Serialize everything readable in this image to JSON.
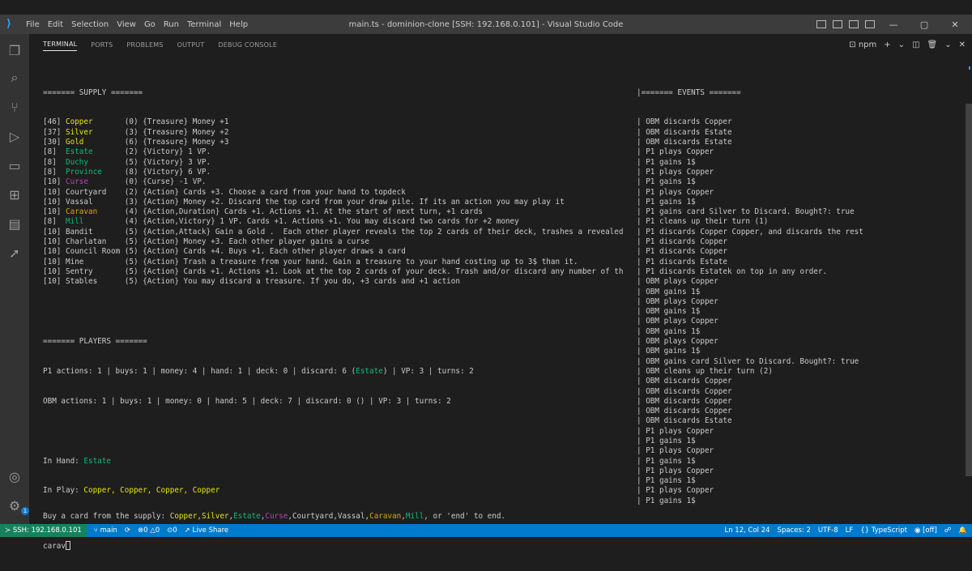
{
  "window": {
    "title": "main.ts - dominion-clone [SSH: 192.168.0.101] - Visual Studio Code",
    "menu": [
      "File",
      "Edit",
      "Selection",
      "View",
      "Go",
      "Run",
      "Terminal",
      "Help"
    ]
  },
  "panel": {
    "tabs": [
      "TERMINAL",
      "PORTS",
      "PROBLEMS",
      "OUTPUT",
      "DEBUG CONSOLE"
    ],
    "active_tab": "TERMINAL",
    "shell_label": "npm"
  },
  "terminal": {
    "supply_header": "======= SUPPLY =======",
    "supply": [
      {
        "count": "[46]",
        "name": "Copper",
        "color": "#e5e510",
        "cost": "(0)",
        "desc": "{Treasure} Money +1"
      },
      {
        "count": "[37]",
        "name": "Silver",
        "color": "#e5e510",
        "cost": "(3)",
        "desc": "{Treasure} Money +2"
      },
      {
        "count": "[30]",
        "name": "Gold",
        "color": "#e5e510",
        "cost": "(6)",
        "desc": "{Treasure} Money +3"
      },
      {
        "count": "[8] ",
        "name": "Estate",
        "color": "#0dbc79",
        "cost": "(2)",
        "desc": "{Victory} 1 VP."
      },
      {
        "count": "[8] ",
        "name": "Duchy",
        "color": "#0dbc79",
        "cost": "(5)",
        "desc": "{Victory} 3 VP."
      },
      {
        "count": "[8] ",
        "name": "Province",
        "color": "#0dbc79",
        "cost": "(8)",
        "desc": "{Victory} 6 VP."
      },
      {
        "count": "[10]",
        "name": "Curse",
        "color": "#bc3fbc",
        "cost": "(0)",
        "desc": "{Curse} -1 VP."
      },
      {
        "count": "[10]",
        "name": "Courtyard",
        "color": "",
        "cost": "(2)",
        "desc": "{Action} Cards +3. Choose a card from your hand to topdeck"
      },
      {
        "count": "[10]",
        "name": "Vassal",
        "color": "",
        "cost": "(3)",
        "desc": "{Action} Money +2. Discard the top card from your draw pile. If its an action you may play it"
      },
      {
        "count": "[10]",
        "name": "Caravan",
        "color": "#e5a00d",
        "cost": "(4)",
        "desc": "{Action,Duration} Cards +1. Actions +1. At the start of next turn, +1 cards"
      },
      {
        "count": "[8] ",
        "name": "Mill",
        "color": "#0dbc79",
        "cost": "(4)",
        "desc": "{Action,Victory} 1 VP. Cards +1. Actions +1. You may discard two cards for +2 money"
      },
      {
        "count": "[10]",
        "name": "Bandit",
        "color": "",
        "cost": "(5)",
        "desc": "{Action,Attack} Gain a Gold .  Each other player reveals the top 2 cards of their deck, trashes a revealed"
      },
      {
        "count": "[10]",
        "name": "Charlatan",
        "color": "",
        "cost": "(5)",
        "desc": "{Action} Money +3. Each other player gains a curse"
      },
      {
        "count": "[10]",
        "name": "Council Room",
        "color": "",
        "cost": "(5)",
        "desc": "{Action} Cards +4. Buys +1. Each other player draws a card"
      },
      {
        "count": "[10]",
        "name": "Mine",
        "color": "",
        "cost": "(5)",
        "desc": "{Action} Trash a treasure from your hand. Gain a treasure to your hand costing up to 3$ than it."
      },
      {
        "count": "[10]",
        "name": "Sentry",
        "color": "",
        "cost": "(5)",
        "desc": "{Action} Cards +1. Actions +1. Look at the top 2 cards of your deck. Trash and/or discard any number of th"
      },
      {
        "count": "[10]",
        "name": "Stables",
        "color": "",
        "cost": "(5)",
        "desc": "{Action} You may discard a treasure. If you do, +3 cards and +1 action"
      }
    ],
    "players_header": "======= PLAYERS =======",
    "p1_line_a": "P1 actions: 1 | buys: 1 | money: 4 | hand: 1 | deck: 0 | discard: 6 (",
    "p1_estate": "Estate",
    "p1_line_b": ") | VP: 3 | turns: 2",
    "obm_line": "OBM actions: 1 | buys: 1 | money: 0 | hand: 5 | deck: 7 | discard: 0 () | VP: 3 | turns: 2",
    "in_hand_label": "In Hand: ",
    "in_hand_card": "Estate",
    "in_play_label": "In Play: ",
    "in_play_cards": "Copper, Copper, Copper, Copper",
    "events_header": "|======= EVENTS =======",
    "events": [
      "| OBM discards Copper",
      "| OBM discards Estate",
      "| OBM discards Estate",
      "| P1 plays Copper",
      "| P1 gains 1$",
      "| P1 plays Copper",
      "| P1 gains 1$",
      "| P1 plays Copper",
      "| P1 gains 1$",
      "| P1 gains card Silver to Discard. Bought?: true",
      "| P1 cleans up their turn (1)",
      "| P1 discards Copper Copper, and discards the rest",
      "| P1 discards Copper",
      "| P1 discards Copper",
      "| P1 discards Estate",
      "| P1 discards Estatek on top in any order.",
      "| OBM plays Copper",
      "| OBM gains 1$",
      "| OBM plays Copper",
      "| OBM gains 1$",
      "| OBM plays Copper",
      "| OBM gains 1$",
      "| OBM plays Copper",
      "| OBM gains 1$",
      "| OBM gains card Silver to Discard. Bought?: true",
      "| OBM cleans up their turn (2)",
      "| OBM discards Copper",
      "| OBM discards Copper",
      "| OBM discards Copper",
      "| OBM discards Copper",
      "| OBM discards Estate",
      "| P1 plays Copper",
      "| P1 gains 1$",
      "| P1 plays Copper",
      "| P1 gains 1$",
      "| P1 plays Copper",
      "| P1 gains 1$",
      "| P1 plays Copper",
      "| P1 gains 1$"
    ],
    "prompt_prefix": "Buy a card from the supply: ",
    "prompt_options": [
      {
        "text": "Copper",
        "color": "#e5e510"
      },
      {
        "text": ",",
        "color": ""
      },
      {
        "text": "Silver",
        "color": "#e5e510"
      },
      {
        "text": ",",
        "color": ""
      },
      {
        "text": "Estate",
        "color": "#0dbc79"
      },
      {
        "text": ",",
        "color": ""
      },
      {
        "text": "Curse",
        "color": "#bc3fbc"
      },
      {
        "text": ",Courtyard,Vassal,",
        "color": ""
      },
      {
        "text": "Caravan",
        "color": "#e5a00d"
      },
      {
        "text": ",",
        "color": ""
      },
      {
        "text": "Mill",
        "color": "#0dbc79"
      },
      {
        "text": ", or 'end' to end.",
        "color": ""
      }
    ],
    "input_value": "carav"
  },
  "statusbar": {
    "remote": "SSH: 192.168.0.101",
    "branch": "main",
    "errors": "0",
    "warnings": "0",
    "ports": "0",
    "live_share": "Live Share",
    "position": "Ln 12, Col 24",
    "spaces": "Spaces: 2",
    "encoding": "UTF-8",
    "eol": "LF",
    "language": "{} TypeScript",
    "prettier": "[off]"
  }
}
